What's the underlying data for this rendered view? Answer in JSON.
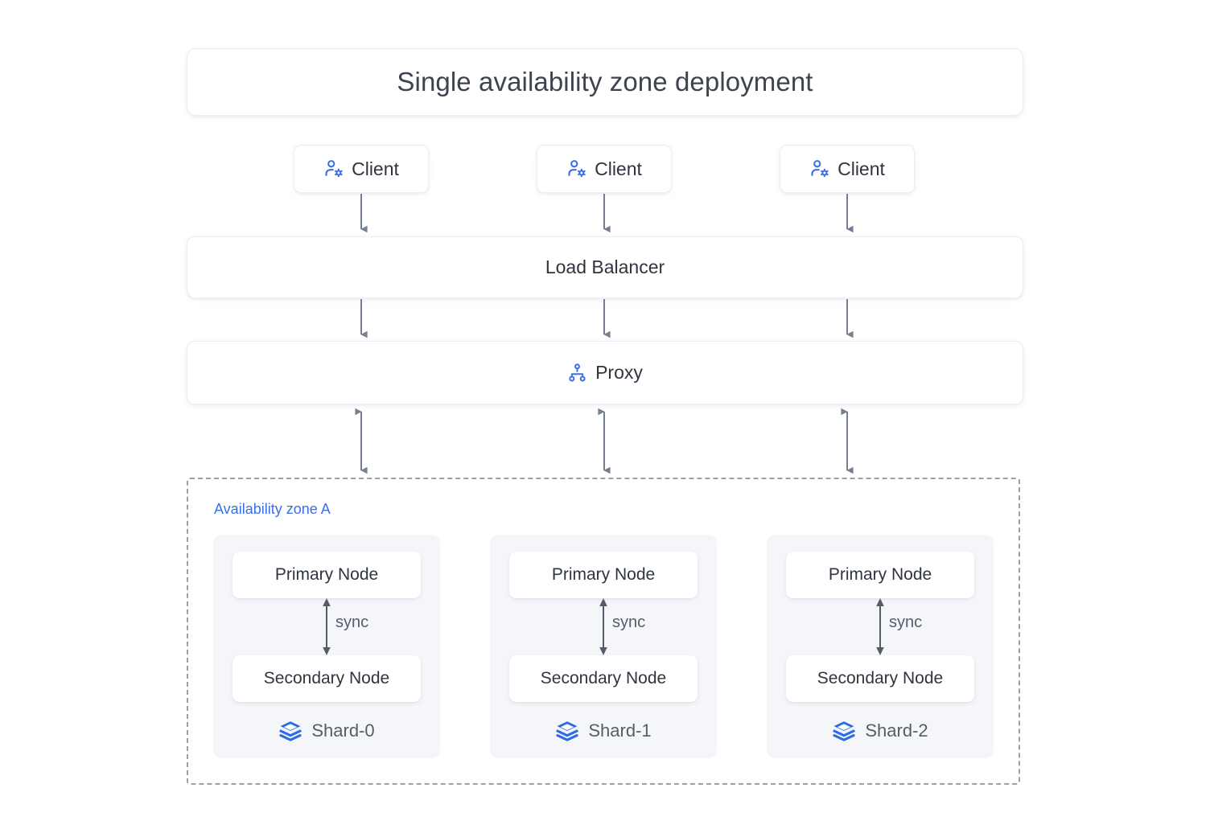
{
  "diagram": {
    "title": "Single availability zone deployment",
    "accent_color": "#3b6fe5",
    "arrow_color": "#767f8f",
    "zone_border_color": "#99a0ad",
    "shard_bg_color": "#f5f6fa"
  },
  "clients": [
    {
      "label": "Client",
      "icon": "user-settings-icon"
    },
    {
      "label": "Client",
      "icon": "user-settings-icon"
    },
    {
      "label": "Client",
      "icon": "user-settings-icon"
    }
  ],
  "load_balancer": {
    "label": "Load Balancer"
  },
  "proxy": {
    "label": "Proxy",
    "icon": "sitemap-icon"
  },
  "availability_zone": {
    "label": "Availability zone A",
    "shards": [
      {
        "name": "Shard-0",
        "icon": "layers-icon",
        "primary": "Primary Node",
        "secondary": "Secondary Node",
        "sync_label": "sync"
      },
      {
        "name": "Shard-1",
        "icon": "layers-icon",
        "primary": "Primary Node",
        "secondary": "Secondary Node",
        "sync_label": "sync"
      },
      {
        "name": "Shard-2",
        "icon": "layers-icon",
        "primary": "Primary Node",
        "secondary": "Secondary Node",
        "sync_label": "sync"
      }
    ]
  }
}
